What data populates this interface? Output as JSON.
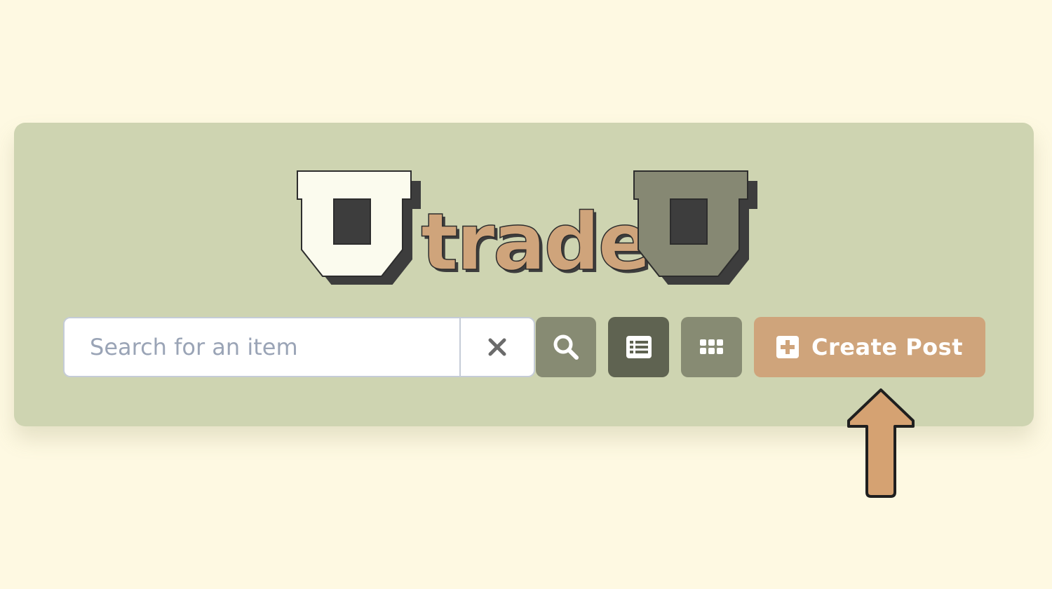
{
  "logo": {
    "left_letter": "U",
    "middle_text": "trade",
    "right_letter": "U",
    "colors": {
      "left_u": "#fbfbee",
      "trade": "#cfa47b",
      "right_u": "#868873",
      "shadow": "#3d3d3d"
    }
  },
  "search": {
    "placeholder": "Search for an item",
    "value": ""
  },
  "toolbar": {
    "clear_icon": "close-icon",
    "search_icon": "search-icon",
    "list_view_icon": "list-view-icon",
    "grid_view_icon": "grid-view-icon",
    "create_post_icon": "plus-square-icon",
    "create_post_label": "Create Post"
  },
  "colors": {
    "page_background": "#fef9e2",
    "panel_background": "#ced4b1",
    "accent": "#cfa47b",
    "button_muted": "#878b73",
    "button_active": "#5f6351"
  },
  "annotation": {
    "pointer": "up-arrow-icon"
  }
}
